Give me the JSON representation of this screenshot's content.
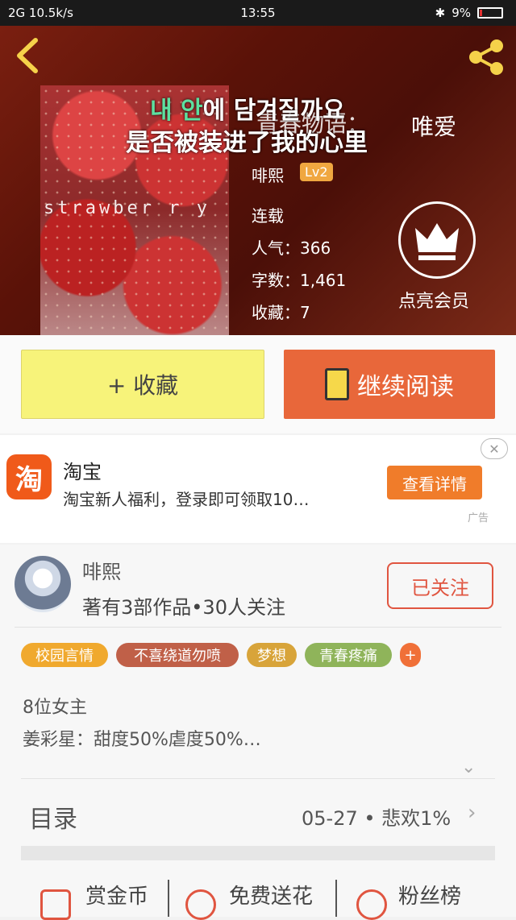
{
  "status_bar": {
    "left": "2G 10.5k/s",
    "time": "13:55",
    "battery": "9%"
  },
  "hero": {
    "lyric_line1_prefix": "내 안",
    "lyric_line1_rest": "에 담겨질까요",
    "lyric_line2": "是否被装进了我的心里",
    "title_part1": "青春物语：",
    "title_part2": "唯爱",
    "cover_word": "strawber r y",
    "author": "啡熙",
    "author_level": "Lv2",
    "status": "连载",
    "popularity_label": "人气：",
    "popularity": "366",
    "words_label": "字数：",
    "words": "1,461",
    "favorites_label": "收藏：",
    "favorites": "7",
    "member_label": "点亮会员"
  },
  "actions": {
    "collect_label": "+ 收藏",
    "read_label": "继续阅读"
  },
  "ad": {
    "logo_char": "淘",
    "name": "淘宝",
    "description": "淘宝新人福利，登录即可领取10…",
    "button_label": "查看详情",
    "close_label": "✕",
    "tag": "广告"
  },
  "author_section": {
    "name": "啡熙",
    "meta": "著有3部作品•30人关注",
    "follow_label": "已关注",
    "tags": [
      {
        "label": "校园言情",
        "color": "#f0a92e"
      },
      {
        "label": "不喜绕道勿喷",
        "color": "#c06048"
      },
      {
        "label": "梦想",
        "color": "#d8a43a"
      },
      {
        "label": "青春疼痛",
        "color": "#8fb45a"
      },
      {
        "label": "+",
        "color": "#f07038"
      }
    ],
    "description_line1": "8位女主",
    "description_line2": "姜彩星：甜度50%虐度50%…"
  },
  "toc": {
    "label": "目录",
    "latest": "05-27 • 悲欢1%"
  },
  "bottom_bar": {
    "items": [
      "赏金币",
      "免费送花",
      "粉丝榜"
    ]
  }
}
